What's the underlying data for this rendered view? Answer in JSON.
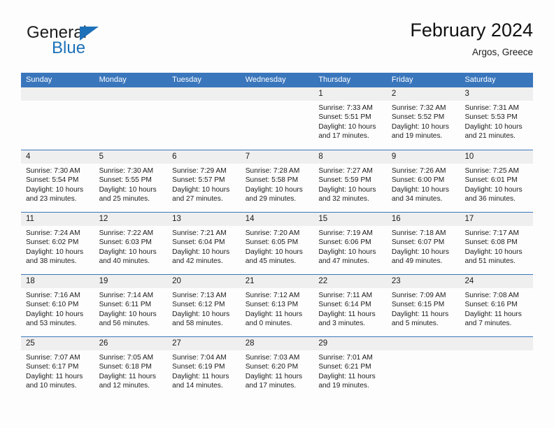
{
  "brand": {
    "name_part1": "General",
    "name_part2": "Blue",
    "accent_color": "#1d71b8"
  },
  "header": {
    "title": "February 2024",
    "location": "Argos, Greece",
    "header_bg": "#3a76bc",
    "band_bg": "#efefef"
  },
  "weekdays": [
    "Sunday",
    "Monday",
    "Tuesday",
    "Wednesday",
    "Thursday",
    "Friday",
    "Saturday"
  ],
  "weeks": [
    [
      {
        "day": "",
        "lines": []
      },
      {
        "day": "",
        "lines": []
      },
      {
        "day": "",
        "lines": []
      },
      {
        "day": "",
        "lines": []
      },
      {
        "day": "1",
        "lines": [
          "Sunrise: 7:33 AM",
          "Sunset: 5:51 PM",
          "Daylight: 10 hours",
          "and 17 minutes."
        ]
      },
      {
        "day": "2",
        "lines": [
          "Sunrise: 7:32 AM",
          "Sunset: 5:52 PM",
          "Daylight: 10 hours",
          "and 19 minutes."
        ]
      },
      {
        "day": "3",
        "lines": [
          "Sunrise: 7:31 AM",
          "Sunset: 5:53 PM",
          "Daylight: 10 hours",
          "and 21 minutes."
        ]
      }
    ],
    [
      {
        "day": "4",
        "lines": [
          "Sunrise: 7:30 AM",
          "Sunset: 5:54 PM",
          "Daylight: 10 hours",
          "and 23 minutes."
        ]
      },
      {
        "day": "5",
        "lines": [
          "Sunrise: 7:30 AM",
          "Sunset: 5:55 PM",
          "Daylight: 10 hours",
          "and 25 minutes."
        ]
      },
      {
        "day": "6",
        "lines": [
          "Sunrise: 7:29 AM",
          "Sunset: 5:57 PM",
          "Daylight: 10 hours",
          "and 27 minutes."
        ]
      },
      {
        "day": "7",
        "lines": [
          "Sunrise: 7:28 AM",
          "Sunset: 5:58 PM",
          "Daylight: 10 hours",
          "and 29 minutes."
        ]
      },
      {
        "day": "8",
        "lines": [
          "Sunrise: 7:27 AM",
          "Sunset: 5:59 PM",
          "Daylight: 10 hours",
          "and 32 minutes."
        ]
      },
      {
        "day": "9",
        "lines": [
          "Sunrise: 7:26 AM",
          "Sunset: 6:00 PM",
          "Daylight: 10 hours",
          "and 34 minutes."
        ]
      },
      {
        "day": "10",
        "lines": [
          "Sunrise: 7:25 AM",
          "Sunset: 6:01 PM",
          "Daylight: 10 hours",
          "and 36 minutes."
        ]
      }
    ],
    [
      {
        "day": "11",
        "lines": [
          "Sunrise: 7:24 AM",
          "Sunset: 6:02 PM",
          "Daylight: 10 hours",
          "and 38 minutes."
        ]
      },
      {
        "day": "12",
        "lines": [
          "Sunrise: 7:22 AM",
          "Sunset: 6:03 PM",
          "Daylight: 10 hours",
          "and 40 minutes."
        ]
      },
      {
        "day": "13",
        "lines": [
          "Sunrise: 7:21 AM",
          "Sunset: 6:04 PM",
          "Daylight: 10 hours",
          "and 42 minutes."
        ]
      },
      {
        "day": "14",
        "lines": [
          "Sunrise: 7:20 AM",
          "Sunset: 6:05 PM",
          "Daylight: 10 hours",
          "and 45 minutes."
        ]
      },
      {
        "day": "15",
        "lines": [
          "Sunrise: 7:19 AM",
          "Sunset: 6:06 PM",
          "Daylight: 10 hours",
          "and 47 minutes."
        ]
      },
      {
        "day": "16",
        "lines": [
          "Sunrise: 7:18 AM",
          "Sunset: 6:07 PM",
          "Daylight: 10 hours",
          "and 49 minutes."
        ]
      },
      {
        "day": "17",
        "lines": [
          "Sunrise: 7:17 AM",
          "Sunset: 6:08 PM",
          "Daylight: 10 hours",
          "and 51 minutes."
        ]
      }
    ],
    [
      {
        "day": "18",
        "lines": [
          "Sunrise: 7:16 AM",
          "Sunset: 6:10 PM",
          "Daylight: 10 hours",
          "and 53 minutes."
        ]
      },
      {
        "day": "19",
        "lines": [
          "Sunrise: 7:14 AM",
          "Sunset: 6:11 PM",
          "Daylight: 10 hours",
          "and 56 minutes."
        ]
      },
      {
        "day": "20",
        "lines": [
          "Sunrise: 7:13 AM",
          "Sunset: 6:12 PM",
          "Daylight: 10 hours",
          "and 58 minutes."
        ]
      },
      {
        "day": "21",
        "lines": [
          "Sunrise: 7:12 AM",
          "Sunset: 6:13 PM",
          "Daylight: 11 hours",
          "and 0 minutes."
        ]
      },
      {
        "day": "22",
        "lines": [
          "Sunrise: 7:11 AM",
          "Sunset: 6:14 PM",
          "Daylight: 11 hours",
          "and 3 minutes."
        ]
      },
      {
        "day": "23",
        "lines": [
          "Sunrise: 7:09 AM",
          "Sunset: 6:15 PM",
          "Daylight: 11 hours",
          "and 5 minutes."
        ]
      },
      {
        "day": "24",
        "lines": [
          "Sunrise: 7:08 AM",
          "Sunset: 6:16 PM",
          "Daylight: 11 hours",
          "and 7 minutes."
        ]
      }
    ],
    [
      {
        "day": "25",
        "lines": [
          "Sunrise: 7:07 AM",
          "Sunset: 6:17 PM",
          "Daylight: 11 hours",
          "and 10 minutes."
        ]
      },
      {
        "day": "26",
        "lines": [
          "Sunrise: 7:05 AM",
          "Sunset: 6:18 PM",
          "Daylight: 11 hours",
          "and 12 minutes."
        ]
      },
      {
        "day": "27",
        "lines": [
          "Sunrise: 7:04 AM",
          "Sunset: 6:19 PM",
          "Daylight: 11 hours",
          "and 14 minutes."
        ]
      },
      {
        "day": "28",
        "lines": [
          "Sunrise: 7:03 AM",
          "Sunset: 6:20 PM",
          "Daylight: 11 hours",
          "and 17 minutes."
        ]
      },
      {
        "day": "29",
        "lines": [
          "Sunrise: 7:01 AM",
          "Sunset: 6:21 PM",
          "Daylight: 11 hours",
          "and 19 minutes."
        ]
      },
      {
        "day": "",
        "lines": []
      },
      {
        "day": "",
        "lines": []
      }
    ]
  ]
}
